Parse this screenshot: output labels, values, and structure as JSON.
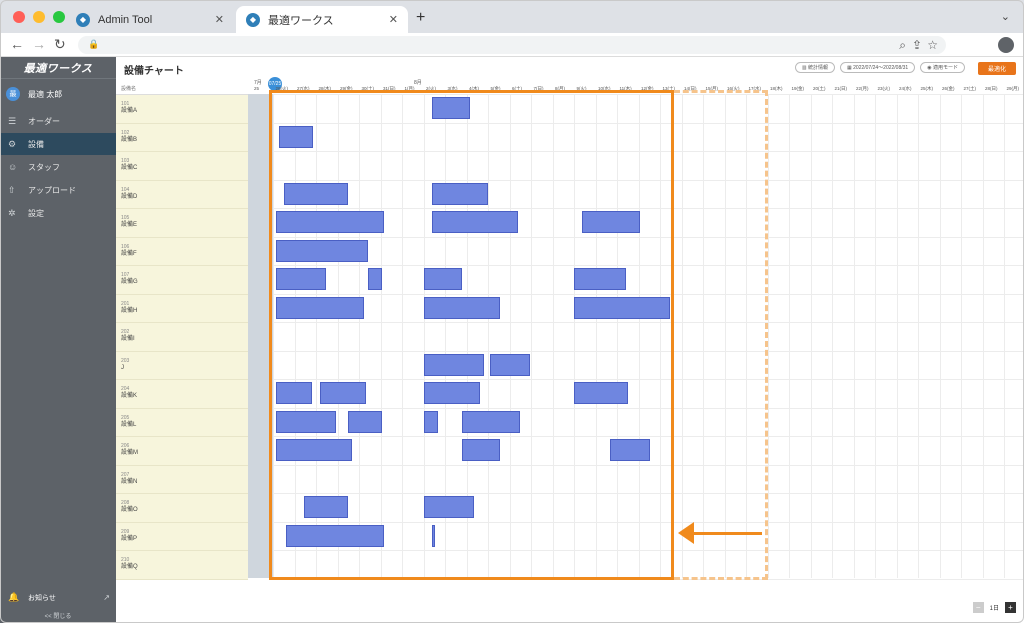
{
  "browser": {
    "tabs": [
      {
        "label": "Admin Tool"
      },
      {
        "label": "最適ワークス"
      }
    ]
  },
  "sidebar": {
    "logo": "最適ワークス",
    "user": {
      "initial": "最",
      "name": "最適 太郎"
    },
    "items": [
      {
        "label": "オーダー",
        "icon": "order-list-icon"
      },
      {
        "label": "設備",
        "icon": "equipment-icon",
        "active": true
      },
      {
        "label": "スタッフ",
        "icon": "staff-icon"
      },
      {
        "label": "アップロード",
        "icon": "upload-icon"
      },
      {
        "label": "設定",
        "icon": "gear-icon"
      }
    ],
    "notice": "お知らせ",
    "collapse": "<< 閉じる"
  },
  "header": {
    "title": "設備チャート",
    "stats_button": "統計情報",
    "date_range": "2022/07/24〜2022/08/31",
    "mode_button": "適用モード",
    "optimize_button": "最適化"
  },
  "table": {
    "column_header": "設備名",
    "equipment": [
      {
        "code": "101",
        "name": "設備A"
      },
      {
        "code": "102",
        "name": "設備B"
      },
      {
        "code": "103",
        "name": "設備C"
      },
      {
        "code": "104",
        "name": "設備D"
      },
      {
        "code": "105",
        "name": "設備E"
      },
      {
        "code": "106",
        "name": "設備F"
      },
      {
        "code": "107",
        "name": "設備G"
      },
      {
        "code": "201",
        "name": "設備H"
      },
      {
        "code": "202",
        "name": "設備I"
      },
      {
        "code": "203",
        "name": "J"
      },
      {
        "code": "204",
        "name": "設備K"
      },
      {
        "code": "205",
        "name": "設備L"
      },
      {
        "code": "206",
        "name": "設備M"
      },
      {
        "code": "207",
        "name": "設備N"
      },
      {
        "code": "208",
        "name": "設備O"
      },
      {
        "code": "209",
        "name": "設備P"
      },
      {
        "code": "210",
        "name": "設備Q"
      }
    ]
  },
  "timeline": {
    "today_badge": "07/25",
    "months": [
      "7月",
      "8月"
    ],
    "days": [
      "25",
      "26(火)",
      "27(水)",
      "28(木)",
      "29(金)",
      "30(土)",
      "31(日)",
      "1(月)",
      "2(火)",
      "3(水)",
      "4(木)",
      "5(金)",
      "6(土)",
      "7(日)",
      "8(月)",
      "9(火)",
      "10(水)",
      "11(木)",
      "12(金)",
      "13(土)",
      "14(日)",
      "15(月)",
      "16(火)",
      "17(水)",
      "18(木)",
      "19(金)",
      "20(土)",
      "21(日)",
      "22(月)",
      "23(火)",
      "24(水)",
      "25(木)",
      "26(金)",
      "27(土)",
      "28(日)",
      "29(月)",
      "30(火)",
      "31(水)"
    ]
  },
  "zoom": {
    "level": "1日"
  },
  "colors": {
    "accent": "#e8741a",
    "block": "#6f86e0",
    "highlight": "#f08a1c"
  }
}
